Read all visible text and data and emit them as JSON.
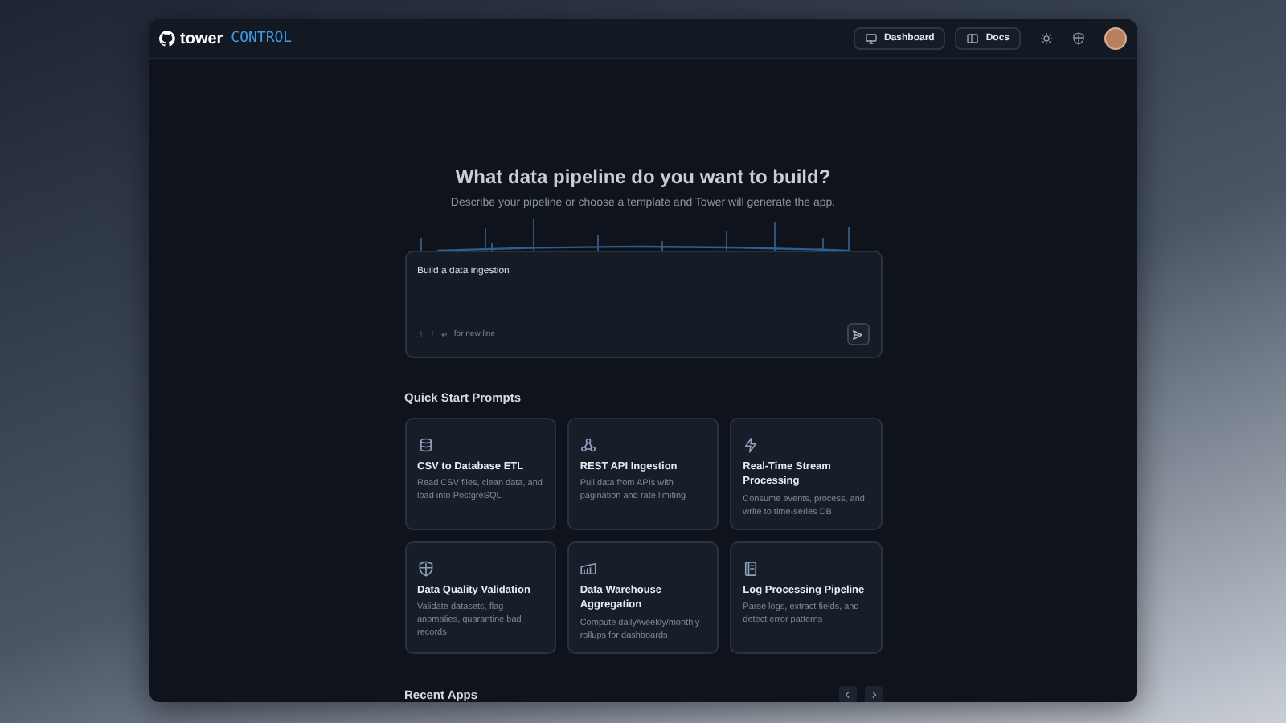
{
  "header": {
    "brand": {
      "name": "tower",
      "suffix": "CONTROL"
    },
    "nav": [
      {
        "label": "Dashboard"
      },
      {
        "label": "Docs"
      }
    ]
  },
  "hero": {
    "title": "What data pipeline do you want to build?",
    "subtitle": "Describe your pipeline or choose a template and Tower will generate the app."
  },
  "prompt": {
    "value": "Build a data ingestion",
    "hint_keys": [
      "⇧",
      "+",
      "↵"
    ],
    "hint": "for new line"
  },
  "quick_start": {
    "title": "Quick Start Prompts",
    "cards": [
      {
        "title": "CSV to Database ETL",
        "description": "Read CSV files, clean data, and load into PostgreSQL"
      },
      {
        "title": "REST API Ingestion",
        "description": "Pull data from APIs with pagination and rate limiting"
      },
      {
        "title": "Real-Time Stream Processing",
        "description": "Consume events, process, and write to time-series DB"
      },
      {
        "title": "Data Quality Validation",
        "description": "Validate datasets, flag anomalies, quarantine bad records"
      },
      {
        "title": "Data Warehouse Aggregation",
        "description": "Compute daily/weekly/monthly rollups for dashboards"
      },
      {
        "title": "Log Processing Pipeline",
        "description": "Parse logs, extract fields, and detect error patterns"
      }
    ]
  },
  "recent": {
    "title": "Recent Apps"
  }
}
